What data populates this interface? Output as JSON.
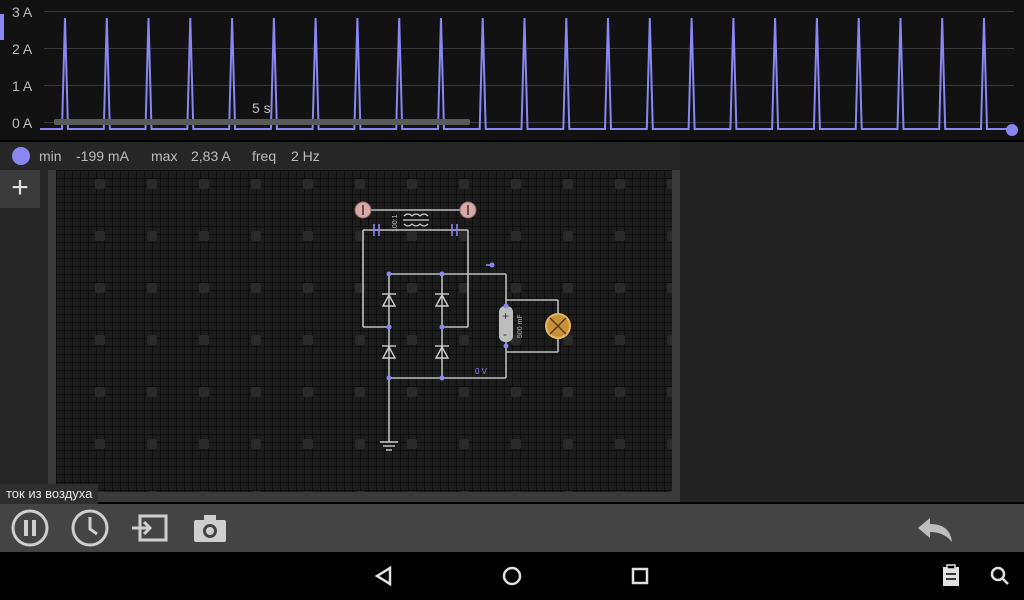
{
  "scope": {
    "y_labels": [
      "3 A",
      "2 A",
      "1 A",
      "0 A"
    ],
    "time_label": "5 s",
    "trace_color": "#8a86f2",
    "pulse_count": 23
  },
  "info": {
    "min_label": "min",
    "min_value": "-199 mA",
    "max_label": "max",
    "max_value": "2,83 A",
    "freq_label": "freq",
    "freq_value": "2 Hz"
  },
  "sidebar": {
    "add_label": "+"
  },
  "circuit": {
    "voltage_label": "0 V",
    "capacitor_label": "500 mF",
    "transformer_label": "100:1"
  },
  "status": {
    "air_label": "ток из воздуха"
  },
  "toolbar": {
    "icons": [
      "pause-icon",
      "history-icon",
      "export-icon",
      "camera-icon",
      "undo-icon"
    ]
  },
  "navbar": {
    "icons": [
      "back-icon",
      "home-icon",
      "recents-icon",
      "clipboard-icon",
      "search-icon"
    ]
  }
}
